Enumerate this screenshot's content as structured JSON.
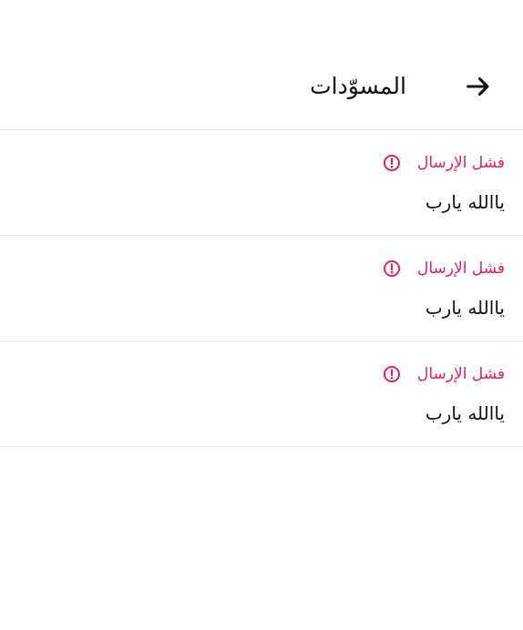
{
  "header": {
    "title": "المسوّدات"
  },
  "colors": {
    "error": "#e0245e",
    "text": "#111111",
    "divider": "#e1e4e8"
  },
  "drafts": [
    {
      "status": "فشل الإرسال",
      "status_icon": "alert-circle-icon",
      "text": "ياالله يارب"
    },
    {
      "status": "فشل الإرسال",
      "status_icon": "alert-circle-icon",
      "text": "ياالله يارب"
    },
    {
      "status": "فشل الإرسال",
      "status_icon": "alert-circle-icon",
      "text": "ياالله يارب"
    }
  ]
}
